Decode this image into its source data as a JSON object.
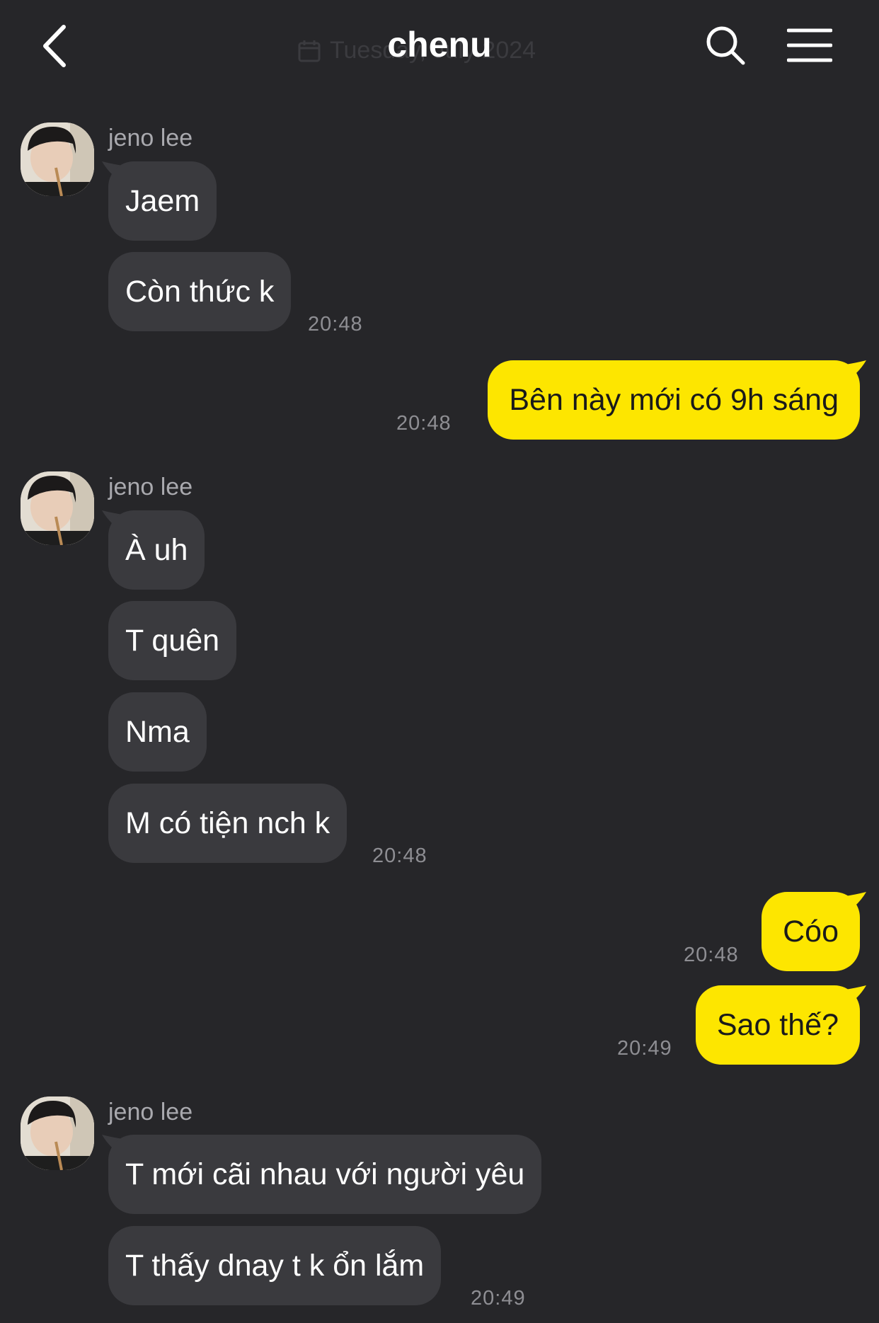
{
  "header": {
    "title": "chenu",
    "date_ghost": "Tuesday, July 2024"
  },
  "conversation": {
    "group1": {
      "sender": "jeno lee",
      "msg1": "Jaem",
      "msg2": "Còn thức k",
      "time": "20:48"
    },
    "out1": {
      "msg": "Bên này mới có 9h sáng",
      "time": "20:48"
    },
    "group2": {
      "sender": "jeno lee",
      "msg1": "À uh",
      "msg2": "T quên",
      "msg3": "Nma",
      "msg4": "M có tiện nch k",
      "time": "20:48"
    },
    "out2": {
      "msg1": "Cóo",
      "time1": "20:48",
      "msg2": "Sao thế?",
      "time2": "20:49"
    },
    "group3": {
      "sender": "jeno lee",
      "msg1": "T mới cãi nhau với người yêu",
      "msg2": "T thấy dnay t k ổn lắm",
      "time": "20:49"
    }
  },
  "colors": {
    "background": "#262629",
    "incoming_bubble": "#3a3a3e",
    "outgoing_bubble": "#fde600",
    "timestamp": "#8e8e93"
  }
}
